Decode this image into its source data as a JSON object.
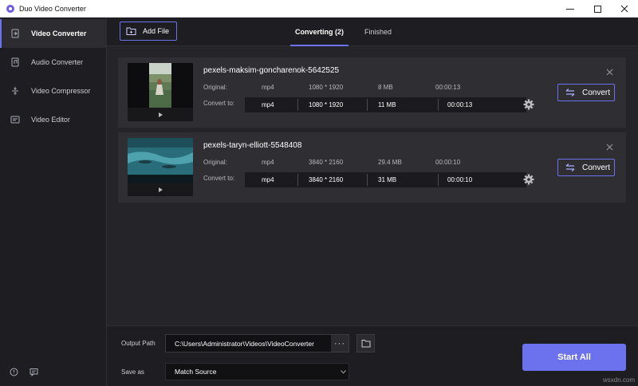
{
  "window": {
    "title": "Duo Video Converter",
    "min_icon": "minimize-icon",
    "max_icon": "maximize-icon",
    "close_icon": "close-icon"
  },
  "sidebar": {
    "items": [
      {
        "label": "Video Converter",
        "icon": "video-convert-icon",
        "active": true
      },
      {
        "label": "Audio Converter",
        "icon": "audio-convert-icon",
        "active": false
      },
      {
        "label": "Video Compressor",
        "icon": "compress-icon",
        "active": false
      },
      {
        "label": "Video Editor",
        "icon": "editor-icon",
        "active": false
      }
    ],
    "bottom_icons": [
      "info-icon",
      "feedback-icon"
    ]
  },
  "toolbar": {
    "add_file_label": "Add File",
    "tabs": [
      {
        "label": "Converting (2)",
        "active": true
      },
      {
        "label": "Finished",
        "active": false
      }
    ]
  },
  "files": [
    {
      "name": "pexels-maksim-goncharenok-5642525",
      "original_label": "Original:",
      "convert_label": "Convert to:",
      "original": {
        "format": "mp4",
        "resolution": "1080 * 1920",
        "size": "8 MB",
        "duration": "00:00:13"
      },
      "target": {
        "format": "mp4",
        "resolution": "1080 * 1920",
        "size": "11 MB",
        "duration": "00:00:13"
      },
      "convert_button": "Convert"
    },
    {
      "name": "pexels-taryn-elliott-5548408",
      "original_label": "Original:",
      "convert_label": "Convert to:",
      "original": {
        "format": "mp4",
        "resolution": "3840 * 2160",
        "size": "29.4 MB",
        "duration": "00:00:10"
      },
      "target": {
        "format": "mp4",
        "resolution": "3840 * 2160",
        "size": "31 MB",
        "duration": "00:00:10"
      },
      "convert_button": "Convert"
    }
  ],
  "footer": {
    "output_path_label": "Output Path",
    "output_path": "C:\\Users\\Administrator\\Videos\\VideoConverter",
    "browse_label": "···",
    "save_as_label": "Save as",
    "save_as_value": "Match Source",
    "start_all_label": "Start All"
  },
  "watermark": "wsxdn.com",
  "colors": {
    "accent": "#6c72ee",
    "sidebar_bg": "#1e1e22",
    "card_bg": "#2e2e33"
  }
}
